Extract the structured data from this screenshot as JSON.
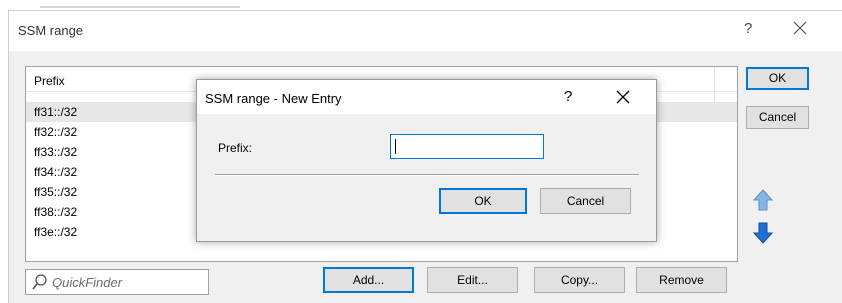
{
  "window": {
    "title": "SSM range",
    "help_glyph": "?"
  },
  "list": {
    "header": "Prefix",
    "rows": [
      "ff31::/32",
      "ff32::/32",
      "ff33::/32",
      "ff34::/32",
      "ff35::/32",
      "ff38::/32",
      "ff3e::/32"
    ],
    "selected_index": 0
  },
  "side_buttons": {
    "ok": "OK",
    "cancel": "Cancel"
  },
  "bottom": {
    "quickfinder_placeholder": "QuickFinder",
    "add": "Add...",
    "edit": "Edit...",
    "copy": "Copy...",
    "remove": "Remove"
  },
  "modal": {
    "title": "SSM range - New Entry",
    "help_glyph": "?",
    "prefix_label": "Prefix:",
    "prefix_value": "",
    "ok": "OK",
    "cancel": "Cancel"
  },
  "colors": {
    "accent": "#0078d7",
    "arrow_up": "#86b6e6",
    "arrow_down": "#1f6fd6"
  },
  "icons": {
    "close": "close-icon",
    "search": "search-icon",
    "move_up": "arrow-up-icon",
    "move_down": "arrow-down-icon"
  }
}
